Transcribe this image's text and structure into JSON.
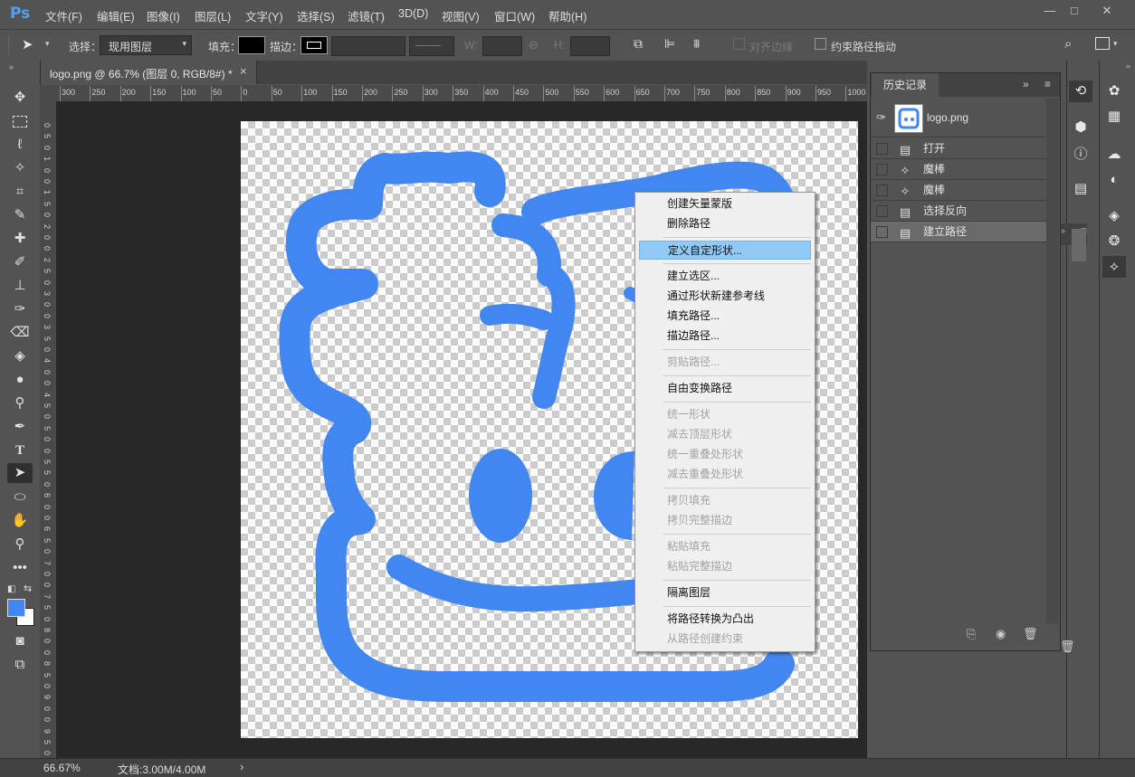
{
  "app": {
    "logo": "Ps"
  },
  "menubar": {
    "items": [
      "文件(F)",
      "编辑(E)",
      "图像(I)",
      "图层(L)",
      "文字(Y)",
      "选择(S)",
      "滤镜(T)",
      "3D(D)",
      "视图(V)",
      "窗口(W)",
      "帮助(H)"
    ]
  },
  "window_controls": {
    "minimize": "—",
    "restore": "□",
    "close": "✕"
  },
  "options": {
    "select_label": "选择：",
    "select_value": "现用图层",
    "fill_label": "填充：",
    "stroke_label": "描边：",
    "w_label": "W:",
    "h_label": "H:",
    "align_edges": "对齐边缘",
    "constrain_path": "约束路径拖动"
  },
  "document": {
    "tab_title": "logo.png @ 66.7% (图层 0, RGB/8#) *",
    "close": "×"
  },
  "rulers": {
    "h_ticks": [
      "300",
      "250",
      "200",
      "150",
      "100",
      "50",
      "0",
      "50",
      "100",
      "150",
      "200",
      "250",
      "300",
      "350",
      "400",
      "450",
      "500",
      "550",
      "600",
      "650",
      "700",
      "750",
      "800",
      "850",
      "900",
      "950",
      "1000"
    ],
    "v_ticks": [
      "0",
      "5",
      "0",
      "1",
      "0",
      "0",
      "1",
      "5",
      "0",
      "2",
      "0",
      "0",
      "2",
      "5",
      "0",
      "3",
      "0",
      "0",
      "3",
      "5",
      "0",
      "4",
      "0",
      "0",
      "4",
      "5",
      "0",
      "5",
      "0",
      "0",
      "5",
      "5",
      "0",
      "6",
      "0",
      "0",
      "6",
      "5",
      "0",
      "7",
      "0",
      "0",
      "7",
      "5",
      "0",
      "8",
      "0",
      "0",
      "8",
      "5",
      "0",
      "9",
      "0",
      "0",
      "9",
      "5",
      "0"
    ]
  },
  "status": {
    "zoom": "66.67%",
    "doc_size": "文档:3.00M/4.00M",
    "arrow": "›"
  },
  "history": {
    "title": "历史记录",
    "snapshot": "logo.png",
    "items": [
      {
        "label": "打开",
        "icon": "document-icon"
      },
      {
        "label": "魔棒",
        "icon": "magic-wand-icon"
      },
      {
        "label": "魔棒",
        "icon": "magic-wand-icon"
      },
      {
        "label": "选择反向",
        "icon": "document-icon"
      },
      {
        "label": "建立路径",
        "icon": "document-icon"
      }
    ]
  },
  "context_menu": {
    "items": [
      {
        "label": "创建矢量蒙版",
        "enabled": true
      },
      {
        "label": "删除路径",
        "enabled": true
      },
      {
        "label": "定义自定形状...",
        "enabled": true,
        "highlighted": true
      },
      {
        "label": "建立选区...",
        "enabled": true
      },
      {
        "label": "通过形状新建参考线",
        "enabled": true
      },
      {
        "label": "填充路径...",
        "enabled": true
      },
      {
        "label": "描边路径...",
        "enabled": true
      },
      {
        "label": "剪贴路径...",
        "enabled": false
      },
      {
        "label": "自由变换路径",
        "enabled": true
      },
      {
        "label": "统一形状",
        "enabled": false
      },
      {
        "label": "减去顶层形状",
        "enabled": false
      },
      {
        "label": "统一重叠处形状",
        "enabled": false
      },
      {
        "label": "减去重叠处形状",
        "enabled": false
      },
      {
        "label": "拷贝填充",
        "enabled": false
      },
      {
        "label": "拷贝完整描边",
        "enabled": false
      },
      {
        "label": "粘贴填充",
        "enabled": false
      },
      {
        "label": "粘贴完整描边",
        "enabled": false
      },
      {
        "label": "隔离图层",
        "enabled": true
      },
      {
        "label": "将路径转换为凸出",
        "enabled": true
      },
      {
        "label": "从路径创建约束",
        "enabled": false
      }
    ]
  },
  "colors": {
    "accent": "#4286f0",
    "highlight": "#91c9f7",
    "ps_blue": "#4ea4f2"
  }
}
